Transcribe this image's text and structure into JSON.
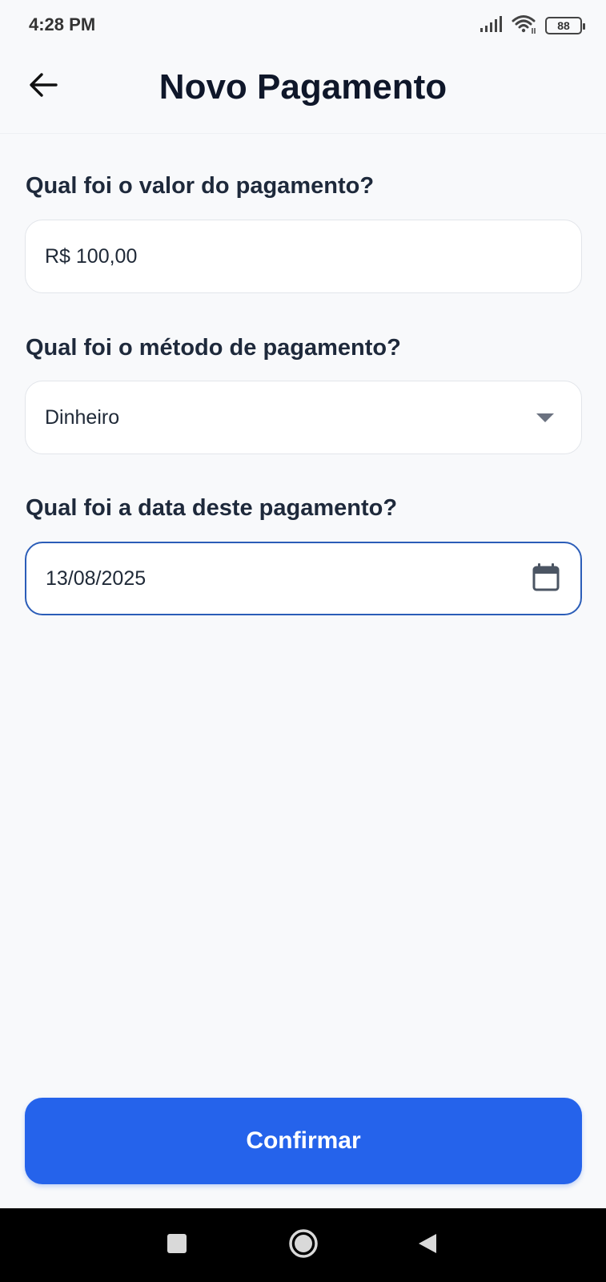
{
  "status_bar": {
    "time": "4:28 PM",
    "battery": "88",
    "icons": [
      "signal-icon",
      "wifi-icon",
      "battery-icon"
    ]
  },
  "header": {
    "title": "Novo Pagamento",
    "back_icon": "arrow-left-icon"
  },
  "form": {
    "amount": {
      "label": "Qual foi o valor do pagamento?",
      "value": "R$ 100,00"
    },
    "method": {
      "label": "Qual foi o método de pagamento?",
      "selected": "Dinheiro",
      "icon": "chevron-down-icon"
    },
    "date": {
      "label": "Qual foi a data deste pagamento?",
      "value": "13/08/2025",
      "icon": "calendar-icon"
    }
  },
  "actions": {
    "confirm_label": "Confirmar"
  },
  "nav_bar": {
    "icons": [
      "recent-apps-icon",
      "home-icon",
      "back-icon"
    ]
  },
  "colors": {
    "accent": "#2563eb",
    "focus_border": "#2b5db8",
    "background": "#f8f9fb",
    "title_text": "#0f172a"
  }
}
